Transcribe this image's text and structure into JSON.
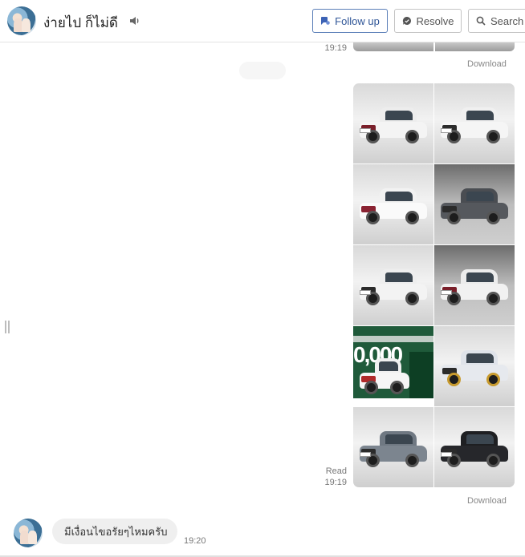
{
  "header": {
    "contact_name": "ง่ายไป ก็ไม่ดี",
    "follow_label": "Follow up",
    "resolve_label": "Resolve",
    "search_label": "Search"
  },
  "messages": {
    "top_time": "19:19",
    "top_download": "Download",
    "album_status": "Read",
    "album_time": "19:19",
    "album_download": "Download",
    "promo_number": "0,000",
    "incoming_text": "มีเงื่อนไขอรัยๆไหมครับ",
    "incoming_time": "19:20"
  },
  "colors": {
    "accent": "#2f5597",
    "bubble_bg": "#efefef",
    "promo_green": "#1f5a3a"
  },
  "icons": [
    "speaker-icon",
    "follow-up-icon",
    "resolve-icon",
    "search-icon",
    "resize-handle-icon"
  ]
}
